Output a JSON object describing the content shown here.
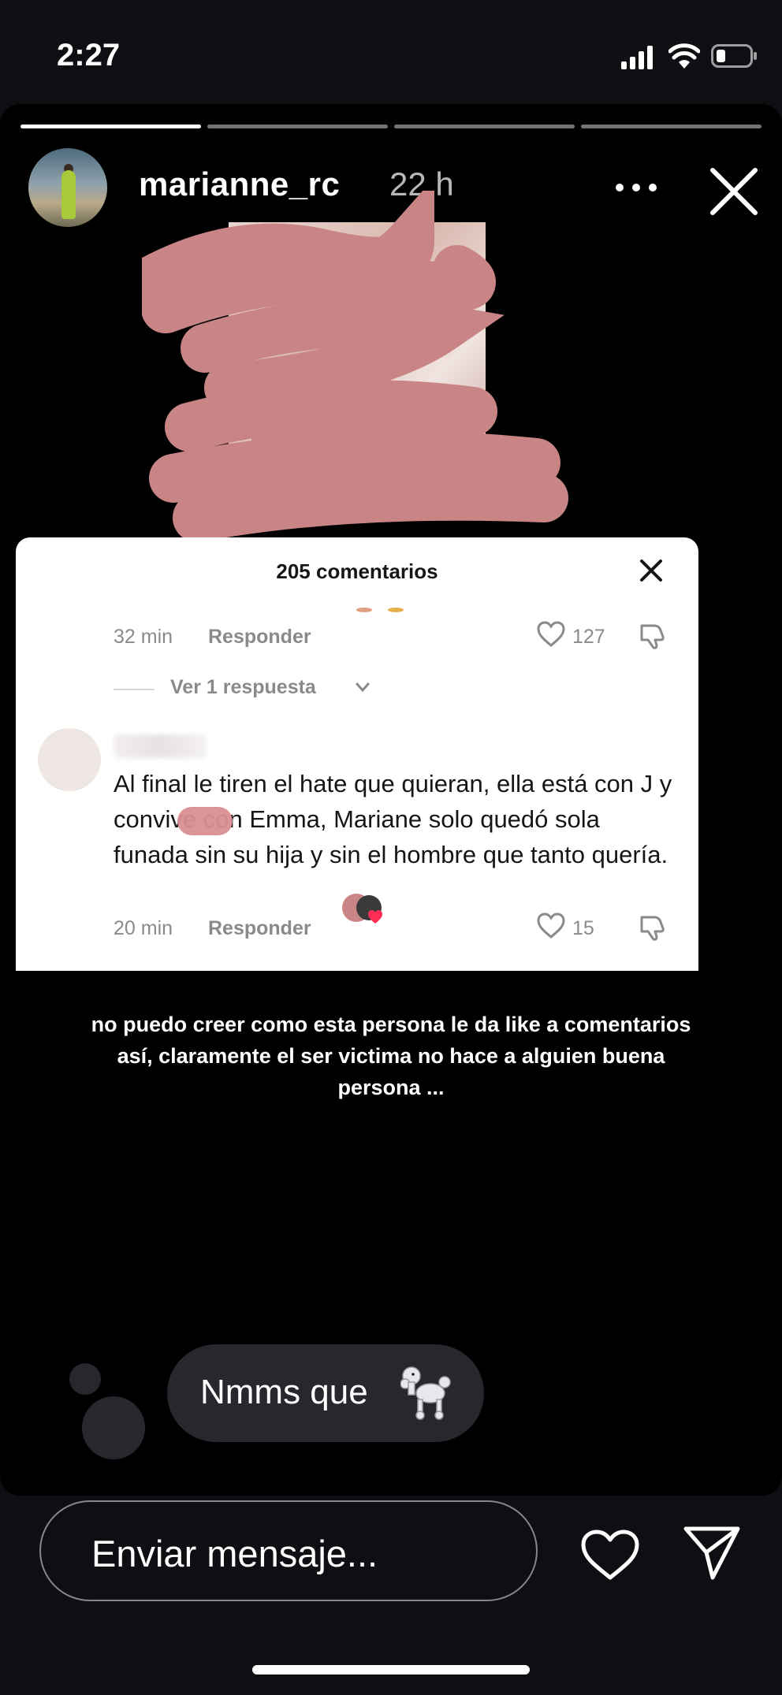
{
  "status_bar": {
    "time": "2:27",
    "signal_icon": "cellular-signal-icon",
    "wifi_icon": "wifi-icon",
    "battery_icon": "battery-icon"
  },
  "story": {
    "segments": [
      {
        "progress": 1.0
      },
      {
        "progress": 0.0
      },
      {
        "progress": 0.0
      },
      {
        "progress": 0.0
      }
    ],
    "username": "marianne_rc",
    "time_ago": "22 h",
    "more_icon": "more-horizontal-icon",
    "close_icon": "close-icon"
  },
  "comment_card": {
    "title": "205 comentarios",
    "first_comment": {
      "time": "32 min",
      "reply_label": "Responder",
      "likes": "127"
    },
    "view_replies": "Ver 1 respuesta",
    "second_comment": {
      "text": "Al final le tiren el hate que quieran, ella está con J      y convive con Emma, Mariane solo quedó sola funada sin su hija y sin el hombre que tanto quería.",
      "time": "20 min",
      "reply_label": "Responder",
      "likes": "15"
    }
  },
  "caption": "no puedo creer como esta persona le da like a comentarios así, claramente el ser victima no hace a alguien buena persona ...",
  "reply": {
    "text": "Nmms que",
    "emoji_icon": "poodle-icon"
  },
  "bottom_bar": {
    "placeholder": "Enviar mensaje...",
    "heart_icon": "heart-icon",
    "send_icon": "send-icon"
  },
  "colors": {
    "background": "#000000",
    "bubble": "#26282e",
    "redaction": "#c98585"
  }
}
